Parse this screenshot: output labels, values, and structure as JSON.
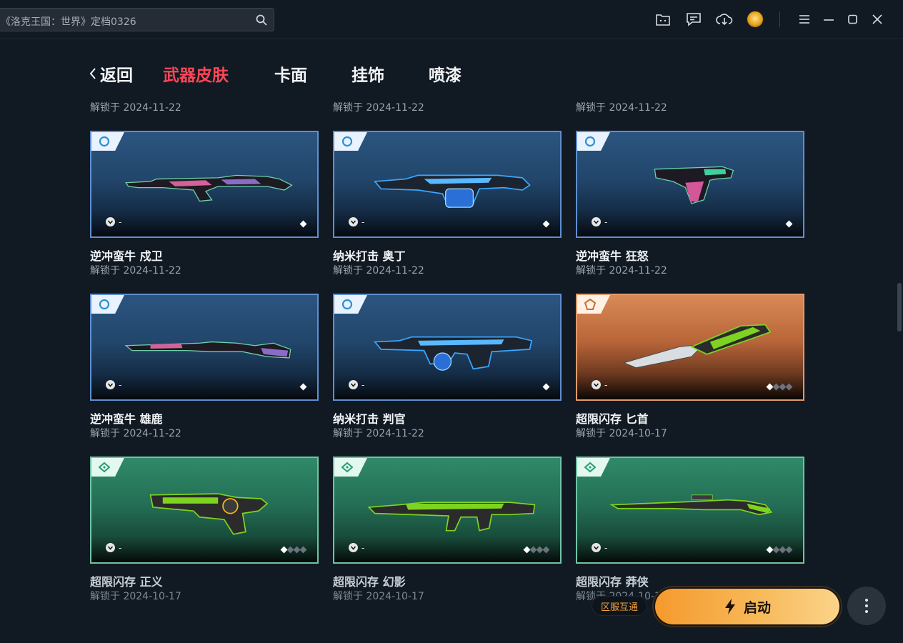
{
  "search": {
    "value": "《洛克王国：世界》定档0326"
  },
  "top_icons": [
    "folder-chat-icon",
    "feedback-icon",
    "download-icon",
    "avatar",
    "menu-icon",
    "minimize-icon",
    "maximize-icon",
    "close-icon"
  ],
  "nav": {
    "back_label": "返回",
    "tabs": [
      {
        "label": "武器皮肤",
        "active": true
      },
      {
        "label": "卡面",
        "active": false
      },
      {
        "label": "挂饰",
        "active": false
      },
      {
        "label": "喷漆",
        "active": false
      }
    ]
  },
  "top_row_unlocks": [
    "解锁于 2024-11-22",
    "解锁于 2024-11-22",
    "解锁于 2024-11-22"
  ],
  "cards": [
    {
      "name": "逆冲蛮牛 戍卫",
      "unlock": "解锁于 2024-11-22",
      "tier_color": "blue",
      "badge": "-",
      "gems_total": 1,
      "gems_on": 1
    },
    {
      "name": "纳米打击 奥丁",
      "unlock": "解锁于 2024-11-22",
      "tier_color": "blue",
      "badge": "-",
      "gems_total": 1,
      "gems_on": 1
    },
    {
      "name": "逆冲蛮牛 狂怒",
      "unlock": "解锁于 2024-11-22",
      "tier_color": "blue",
      "badge": "-",
      "gems_total": 1,
      "gems_on": 1
    },
    {
      "name": "逆冲蛮牛 雄鹿",
      "unlock": "解锁于 2024-11-22",
      "tier_color": "blue",
      "badge": "-",
      "gems_total": 1,
      "gems_on": 1
    },
    {
      "name": "纳米打击 判官",
      "unlock": "解锁于 2024-11-22",
      "tier_color": "blue",
      "badge": "-",
      "gems_total": 1,
      "gems_on": 1
    },
    {
      "name": "超限闪存 匕首",
      "unlock": "解锁于 2024-10-17",
      "tier_color": "orange",
      "badge": "-",
      "gems_total": 4,
      "gems_on": 1
    },
    {
      "name": "超限闪存 正义",
      "unlock": "解锁于 2024-10-17",
      "tier_color": "green",
      "badge": "-",
      "gems_total": 4,
      "gems_on": 1
    },
    {
      "name": "超限闪存 幻影",
      "unlock": "解锁于 2024-10-17",
      "tier_color": "green",
      "badge": "-",
      "gems_total": 4,
      "gems_on": 1
    },
    {
      "name": "超限闪存 莽侠",
      "unlock": "解锁于 2024-10-17",
      "tier_color": "green",
      "badge": "-",
      "gems_total": 4,
      "gems_on": 1
    }
  ],
  "colors": {
    "active_tab": "#ff4655",
    "launch_gradient_start": "#f59a2d",
    "launch_gradient_end": "#fad48a",
    "region_chip_text": "#f29f3a"
  },
  "region_chip": "区服互通",
  "launch": {
    "label": "启动"
  }
}
